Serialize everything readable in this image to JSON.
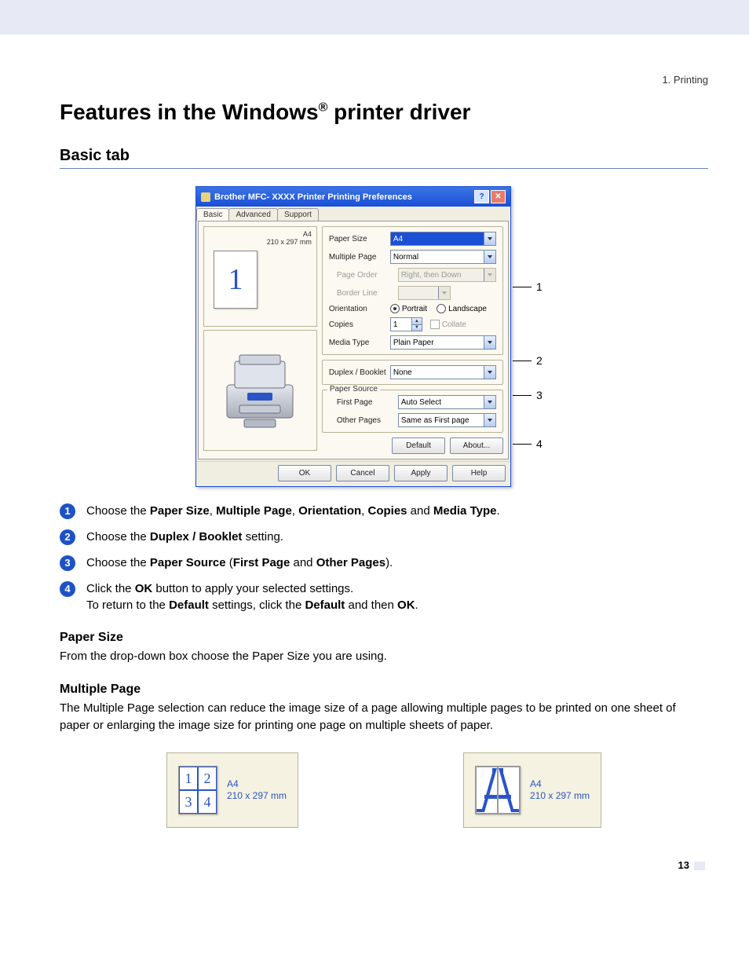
{
  "breadcrumb": "1. Printing",
  "h1_pre": "Features in the Windows",
  "h1_sup": "®",
  "h1_post": " printer driver",
  "h2": "Basic tab",
  "dialog": {
    "title": "Brother MFC- XXXX    Printer Printing Preferences",
    "help_glyph": "?",
    "close_glyph": "✕",
    "tabs": {
      "basic": "Basic",
      "advanced": "Advanced",
      "support": "Support"
    },
    "preview": {
      "label1": "A4",
      "label2": "210 x 297 mm",
      "glyph": "1"
    },
    "fields": {
      "paper_size_label": "Paper Size",
      "paper_size_value": "A4",
      "multiple_page_label": "Multiple Page",
      "multiple_page_value": "Normal",
      "page_order_label": "Page Order",
      "page_order_value": "Right, then Down",
      "border_line_label": "Border Line",
      "border_line_value": "",
      "orientation_label": "Orientation",
      "orientation_portrait": "Portrait",
      "orientation_landscape": "Landscape",
      "copies_label": "Copies",
      "copies_value": "1",
      "collate_label": "Collate",
      "media_type_label": "Media Type",
      "media_type_value": "Plain Paper",
      "duplex_label": "Duplex / Booklet",
      "duplex_value": "None",
      "paper_source_group": "Paper Source",
      "first_page_label": "First Page",
      "first_page_value": "Auto Select",
      "other_pages_label": "Other Pages",
      "other_pages_value": "Same as First page"
    },
    "buttons": {
      "default": "Default",
      "about": "About...",
      "ok": "OK",
      "cancel": "Cancel",
      "apply": "Apply",
      "help": "Help"
    }
  },
  "callouts": {
    "c1": "1",
    "c2": "2",
    "c3": "3",
    "c4": "4"
  },
  "steps": {
    "s1_a": "Choose the ",
    "s1_b1": "Paper Size",
    "s1_c1": ", ",
    "s1_b2": "Multiple Page",
    "s1_c2": ", ",
    "s1_b3": "Orientation",
    "s1_c3": ", ",
    "s1_b4": "Copies",
    "s1_c4": " and ",
    "s1_b5": "Media Type",
    "s1_c5": ".",
    "s2_a": "Choose the ",
    "s2_b": "Duplex / Booklet",
    "s2_c": " setting.",
    "s3_a": "Choose the ",
    "s3_b1": "Paper Source",
    "s3_c1": " (",
    "s3_b2": "First Page",
    "s3_c2": " and ",
    "s3_b3": "Other Pages",
    "s3_c3": ").",
    "s4_a": "Click the ",
    "s4_b1": "OK",
    "s4_c1": " button to apply your selected settings.",
    "s4_line2_a": "To return to the ",
    "s4_line2_b1": "Default",
    "s4_line2_c1": " settings, click the ",
    "s4_line2_b2": "Default",
    "s4_line2_c2": " and then ",
    "s4_line2_b3": "OK",
    "s4_line2_c3": "."
  },
  "sub_paper_size": "Paper Size",
  "para_paper_size": "From the drop-down box choose the Paper Size you are using.",
  "sub_multiple_page": "Multiple Page",
  "para_multiple_page": "The Multiple Page selection can reduce the image size of a page allowing multiple pages to be printed on one sheet of paper or enlarging the image size for printing one page on multiple sheets of paper.",
  "example_label_1": "A4",
  "example_label_2": "210 x 297 mm",
  "ex1_cells": {
    "a": "1",
    "b": "2",
    "c": "3",
    "d": "4"
  },
  "page_number": "13"
}
